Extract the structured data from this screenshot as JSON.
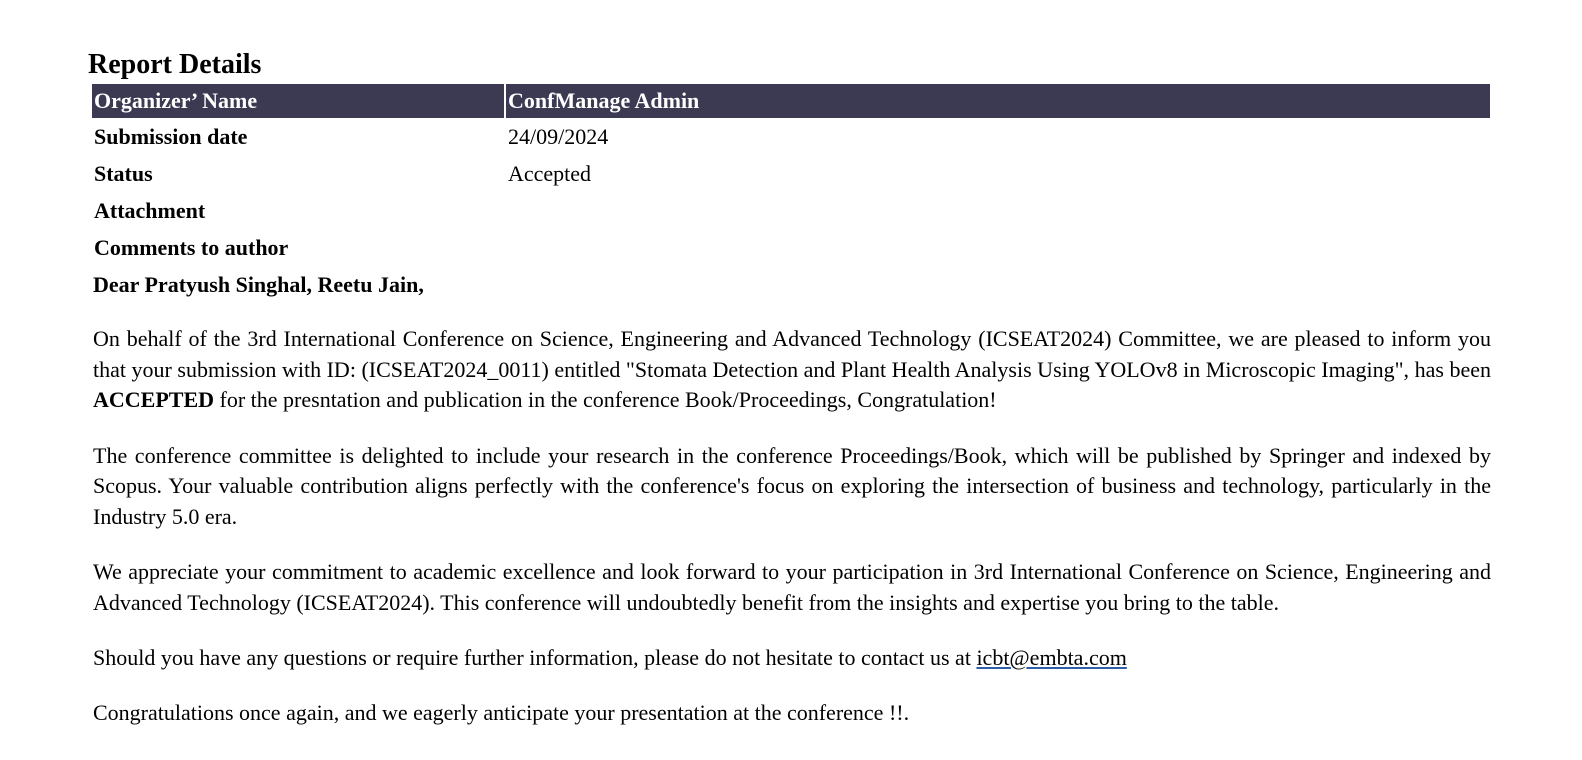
{
  "report": {
    "title": "Report Details",
    "header_row": {
      "label": "Organizer’ Name",
      "value": "ConfManage Admin"
    },
    "rows": [
      {
        "label": "Submission date",
        "value": "24/09/2024"
      },
      {
        "label": "Status",
        "value": "Accepted"
      },
      {
        "label": "Attachment",
        "value": ""
      },
      {
        "label": "Comments to author",
        "value": ""
      }
    ],
    "header_color": "#3c3a52"
  },
  "letter": {
    "greeting": "Dear Pratyush Singhal, Reetu Jain,",
    "p1_before": "On behalf of the 3rd International Conference on Science, Engineering and Advanced Technology (ICSEAT2024) Committee, we are pleased to inform you that your submission with ID: (ICSEAT2024_0011) entitled \"Stomata Detection and Plant Health Analysis Using YOLOv8 in Microscopic Imaging\", has been ",
    "p1_bold": "ACCEPTED",
    "p1_after": " for the presntation and publication in the conference Book/Proceedings, Congratulation!",
    "p2": "The conference committee is delighted to include your research in the conference Proceedings/Book, which will be published by Springer and indexed by Scopus. Your valuable contribution aligns perfectly with the conference's focus on exploring the intersection of business and technology, particularly in the Industry 5.0 era.",
    "p3": "We appreciate your commitment to academic excellence and look forward to your participation in 3rd International Conference on Science, Engineering and Advanced Technology (ICSEAT2024). This conference will undoubtedly benefit from the insights and expertise you bring to the table.",
    "p4_before": "Should you have any questions or require further information, please do not hesitate to contact us at ",
    "contact_email": "icbt@embta.com",
    "p5": "Congratulations once again, and we eagerly anticipate your presentation at the conference !!."
  }
}
